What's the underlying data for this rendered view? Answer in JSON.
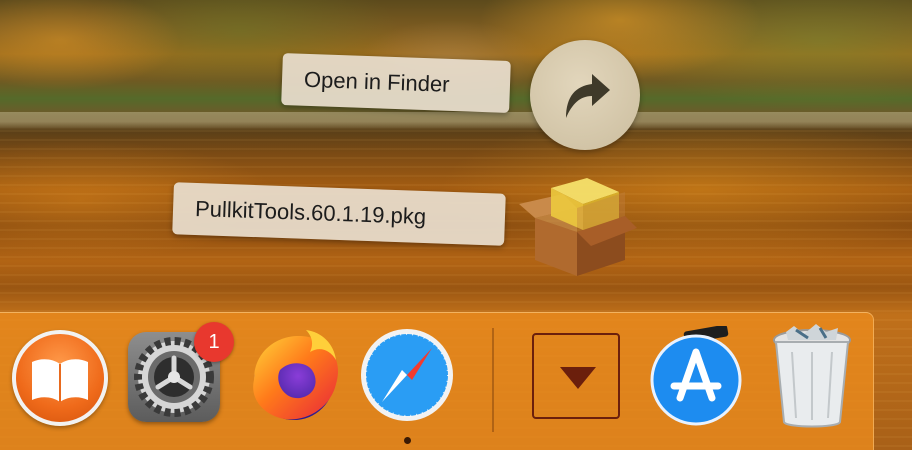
{
  "desktop": {
    "drag_labels": {
      "open_in_finder": "Open in Finder",
      "file_name": "PullkitTools.60.1.19.pkg"
    },
    "icons": {
      "finder_arrow": "curved-arrow-icon",
      "package": "package-installer-icon"
    }
  },
  "dock": {
    "items": [
      {
        "name": "Books",
        "icon": "books-icon"
      },
      {
        "name": "System Preferences",
        "icon": "gear-icon",
        "badge": "1"
      },
      {
        "name": "Firefox",
        "icon": "firefox-icon"
      },
      {
        "name": "Safari",
        "icon": "compass-icon",
        "running": true
      },
      {
        "name": "Downloads",
        "icon": "downloads-stack-icon"
      },
      {
        "name": "App Store",
        "icon": "app-store-icon"
      },
      {
        "name": "Trash",
        "icon": "trash-icon"
      }
    ]
  },
  "colors": {
    "dock_tint": "#ec8c1e",
    "label_bg": "#e8decd",
    "badge_red": "#e8382e",
    "downloads_border": "#6b1f0c"
  }
}
